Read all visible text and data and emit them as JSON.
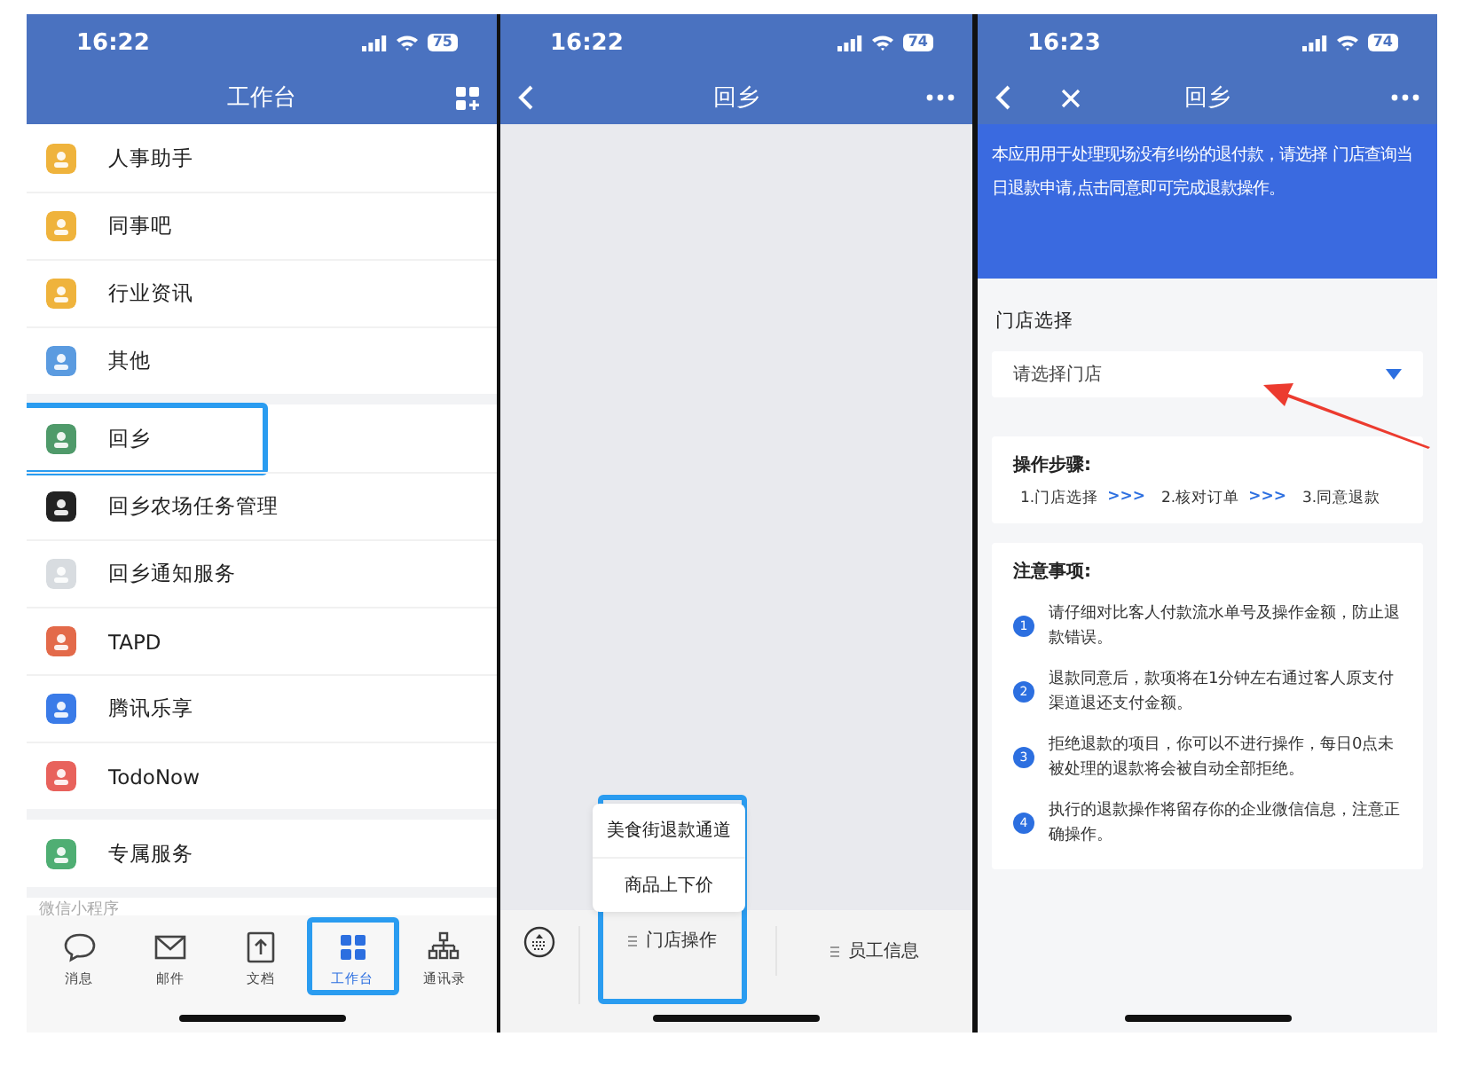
{
  "workbench_screen": {
    "status_bar": {
      "time": "16:22",
      "battery": "75"
    },
    "title": "工作台",
    "app_groups": [
      {
        "items": [
          {
            "label": "人事助手",
            "color": "#efb33c",
            "highlighted": false
          },
          {
            "label": "同事吧",
            "color": "#efb33c",
            "highlighted": false
          },
          {
            "label": "行业资讯",
            "color": "#efb33c",
            "highlighted": false
          },
          {
            "label": "其他",
            "color": "#5b9be0",
            "highlighted": false
          }
        ]
      },
      {
        "items": [
          {
            "label": "回乡",
            "color": "#4f9a6a",
            "highlighted": true
          },
          {
            "label": "回乡农场任务管理",
            "color": "#222222",
            "highlighted": false
          },
          {
            "label": "回乡通知服务",
            "color": "#d8dce0",
            "highlighted": false
          },
          {
            "label": "TAPD",
            "color": "#e36a4a",
            "highlighted": false
          },
          {
            "label": "腾讯乐享",
            "color": "#3a7be8",
            "highlighted": false
          },
          {
            "label": "TodoNow",
            "color": "#e8625c",
            "highlighted": false
          }
        ]
      },
      {
        "items": [
          {
            "label": "专属服务",
            "color": "#4fae73",
            "highlighted": false
          }
        ]
      }
    ],
    "section_label": "微信小程序",
    "tabs": [
      {
        "label": "消息",
        "selected": false,
        "highlighted": false
      },
      {
        "label": "邮件",
        "selected": false,
        "highlighted": false
      },
      {
        "label": "文档",
        "selected": false,
        "highlighted": false
      },
      {
        "label": "工作台",
        "selected": true,
        "highlighted": true
      },
      {
        "label": "通讯录",
        "selected": false,
        "highlighted": false
      }
    ]
  },
  "menu_screen": {
    "status_bar": {
      "time": "16:22",
      "battery": "74"
    },
    "title": "回乡",
    "menu_bar": [
      {
        "label": "门店操作",
        "highlighted": true,
        "submenu": [
          "美食街退款通道",
          "商品上下价"
        ]
      },
      {
        "label": "员工信息",
        "highlighted": false
      }
    ]
  },
  "refund_screen": {
    "status_bar": {
      "time": "16:23",
      "battery": "74"
    },
    "title": "回乡",
    "banner_text": "本应用用于处理现场没有纠纷的退付款，请选择 门店查询当日退款申请,点击同意即可完成退款操作。",
    "store_section": {
      "title": "门店选择",
      "placeholder": "请选择门店",
      "pointed_at": true
    },
    "steps": {
      "title": "操作步骤:",
      "items": [
        "1.门店选择",
        "2.核对订单",
        "3.同意退款"
      ],
      "separator": ">>>"
    },
    "notes": {
      "title": "注意事项:",
      "items": [
        {
          "number": "1",
          "text": "请仔细对比客人付款流水单号及操作金额，防止退款错误。"
        },
        {
          "number": "2",
          "text": "退款同意后，款项将在1分钟左右通过客人原支付渠道退还支付金额。"
        },
        {
          "number": "3",
          "text": "拒绝退款的项目，你可以不进行操作，每日0点未被处理的退款将会被自动全部拒绝。"
        },
        {
          "number": "4",
          "text": "执行的退款操作将留存你的企业微信信息，注意正确操作。"
        }
      ]
    }
  }
}
